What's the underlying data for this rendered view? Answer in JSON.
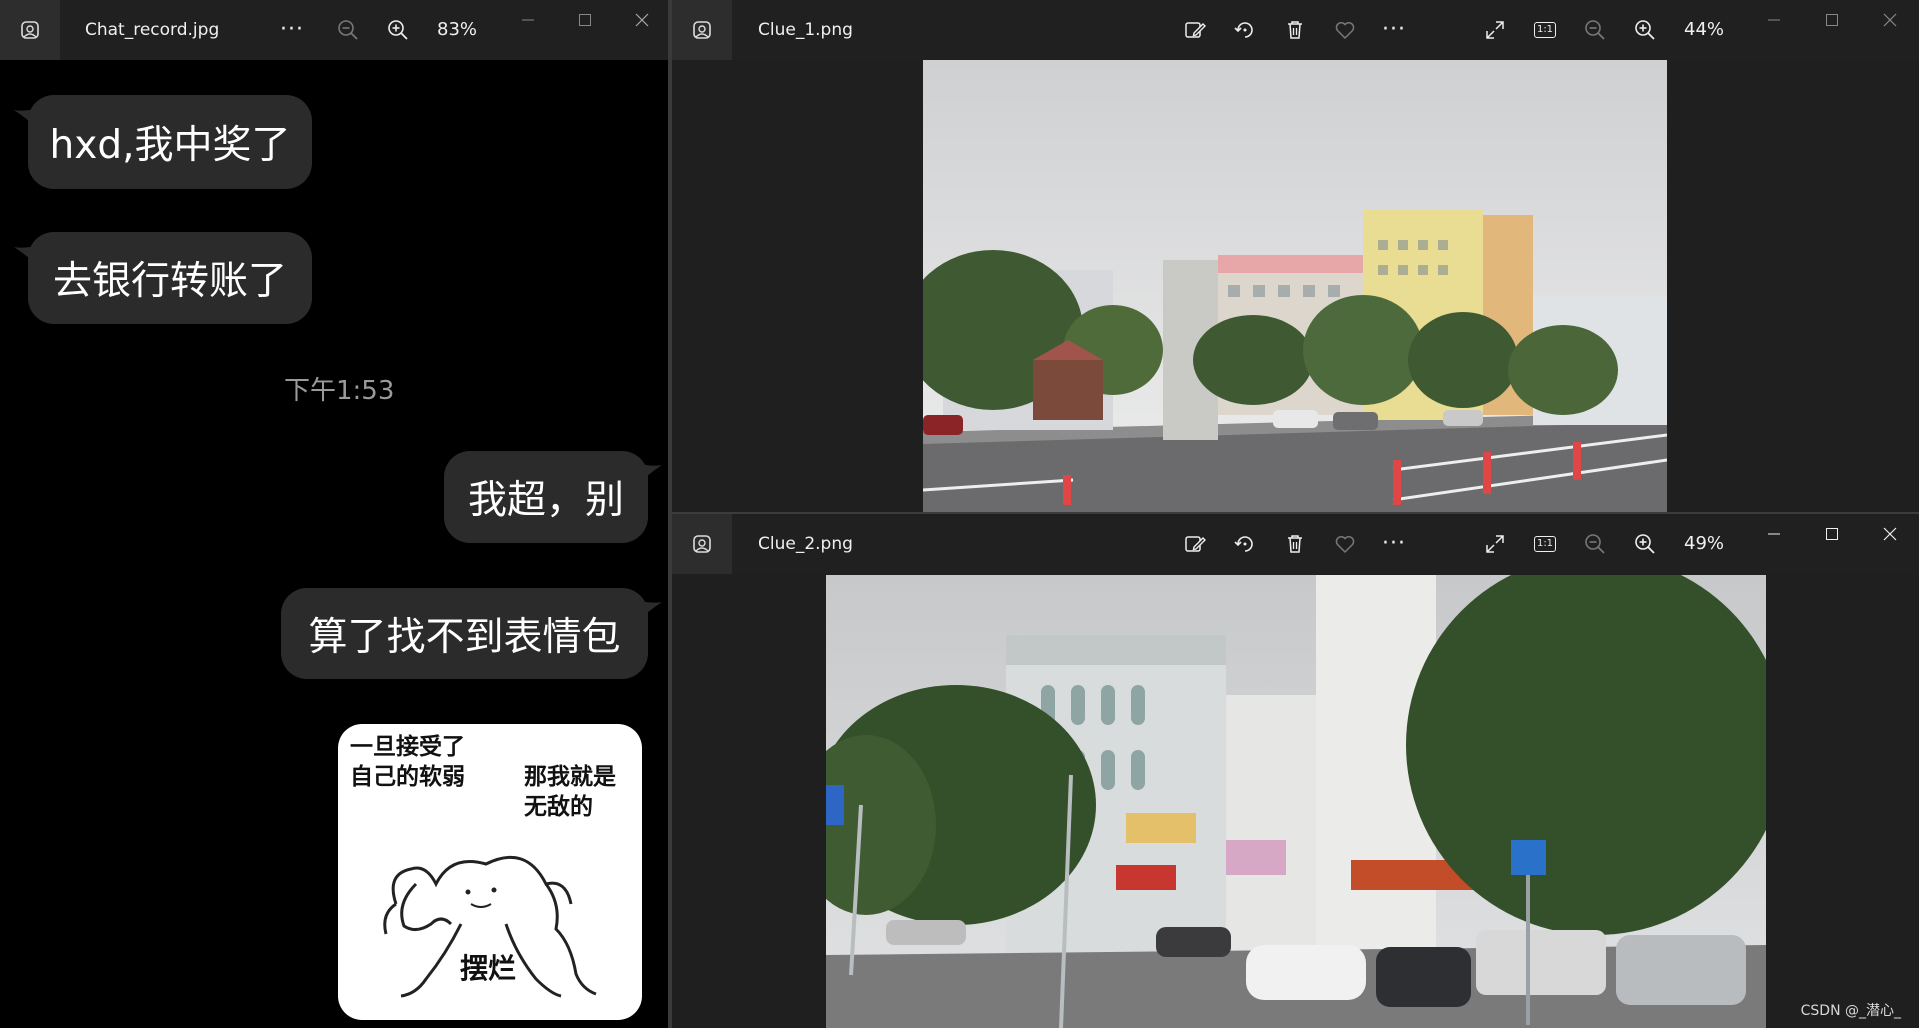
{
  "left_window": {
    "file_name": "Chat_record.jpg",
    "zoom": "83%",
    "more_label": "···"
  },
  "chat": {
    "messages": [
      {
        "side": "left",
        "text": "hxd,我中奖了"
      },
      {
        "side": "left",
        "text": "去银行转账了"
      },
      {
        "side": "right",
        "text": "我超，别"
      },
      {
        "side": "right",
        "text": "算了找不到表情包"
      }
    ],
    "timestamp": "下午1:53",
    "sticker": {
      "text_top_left": "一旦接受了\n自己的软弱",
      "text_top_right": "那我就是\n无敌的",
      "text_bottom": "摆烂"
    }
  },
  "top_right_window": {
    "file_name": "Clue_1.png",
    "zoom": "44%",
    "more_label": "···",
    "actual_size_label": "1:1"
  },
  "bottom_right_window": {
    "file_name": "Clue_2.png",
    "zoom": "49%",
    "more_label": "···",
    "actual_size_label": "1:1"
  },
  "watermark": "CSDN @_潜心_",
  "icons": {
    "app": "photos-app-icon",
    "edit": "edit-image-icon",
    "rotate": "rotate-icon",
    "delete": "delete-icon",
    "favorite": "heart-icon",
    "fullscreen": "expand-icon",
    "zoom_out": "zoom-out-icon",
    "zoom_in": "zoom-in-icon"
  },
  "colors": {
    "titlebar": "#202020",
    "bubble": "#2b2b2b",
    "background": "#000000"
  }
}
